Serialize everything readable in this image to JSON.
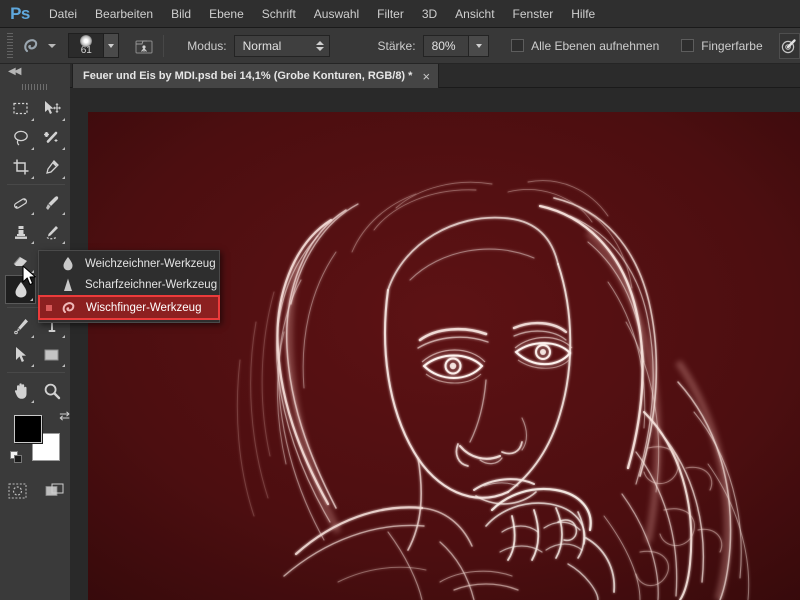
{
  "app": {
    "name": "Ps",
    "logo_color": "#5fa8dd"
  },
  "menubar": {
    "items": [
      {
        "label": "Datei"
      },
      {
        "label": "Bearbeiten"
      },
      {
        "label": "Bild"
      },
      {
        "label": "Ebene"
      },
      {
        "label": "Schrift"
      },
      {
        "label": "Auswahl"
      },
      {
        "label": "Filter"
      },
      {
        "label": "3D"
      },
      {
        "label": "Ansicht"
      },
      {
        "label": "Fenster"
      },
      {
        "label": "Hilfe"
      }
    ]
  },
  "options_bar": {
    "brush_size": "61",
    "brush_preset_icon": "soft-round-brush-icon",
    "brush_panel_icon": "brush-panel-icon",
    "mode_label": "Modus:",
    "mode_value": "Normal",
    "strength_label": "Stärke:",
    "strength_value": "80%",
    "sample_all_layers_label": "Alle Ebenen aufnehmen",
    "sample_all_layers_checked": false,
    "finger_paint_label": "Fingerfarbe",
    "finger_paint_checked": false,
    "pressure_button_icon": "tablet-pressure-icon"
  },
  "document_tab": {
    "title": "Feuer und Eis by MDI.psd bei 14,1% (Grobe Konturen, RGB/8) *",
    "close_glyph": "×"
  },
  "left_panel": {
    "collapse_glyph": "◀◀"
  },
  "toolbox": {
    "tools": [
      {
        "name": "rectangular-marquee-tool",
        "row": 0,
        "col": 0,
        "has_corner": true
      },
      {
        "name": "move-tool",
        "row": 0,
        "col": 1,
        "has_corner": true
      },
      {
        "name": "lasso-tool",
        "row": 1,
        "col": 0,
        "has_corner": true
      },
      {
        "name": "magic-wand-tool",
        "row": 1,
        "col": 1,
        "has_corner": true
      },
      {
        "name": "crop-tool",
        "row": 2,
        "col": 0,
        "has_corner": true
      },
      {
        "name": "eyedropper-tool",
        "row": 2,
        "col": 1,
        "has_corner": true
      },
      {
        "name": "healing-brush-tool",
        "row": 3,
        "col": 0,
        "has_corner": true
      },
      {
        "name": "brush-tool",
        "row": 3,
        "col": 1,
        "has_corner": true
      },
      {
        "name": "clone-stamp-tool",
        "row": 4,
        "col": 0,
        "has_corner": true
      },
      {
        "name": "history-brush-tool",
        "row": 4,
        "col": 1,
        "has_corner": true
      },
      {
        "name": "eraser-tool",
        "row": 5,
        "col": 0,
        "has_corner": true
      },
      {
        "name": "gradient-tool",
        "row": 5,
        "col": 1,
        "has_corner": true
      },
      {
        "name": "blur-tool",
        "row": 6,
        "col": 0,
        "has_corner": true,
        "active": true
      },
      {
        "name": "dodge-tool",
        "row": 6,
        "col": 1,
        "has_corner": true
      },
      {
        "name": "pen-tool",
        "row": 7,
        "col": 0,
        "has_corner": true
      },
      {
        "name": "type-tool",
        "row": 7,
        "col": 1,
        "has_corner": true
      },
      {
        "name": "path-selection-tool",
        "row": 8,
        "col": 0,
        "has_corner": true
      },
      {
        "name": "rectangle-shape-tool",
        "row": 8,
        "col": 1,
        "has_corner": true
      },
      {
        "name": "hand-tool",
        "row": 9,
        "col": 0,
        "has_corner": true
      },
      {
        "name": "zoom-tool",
        "row": 9,
        "col": 1,
        "has_corner": false
      }
    ],
    "foreground_color": "#000000",
    "background_color": "#ffffff",
    "quick_mask_icon": "quick-mask-icon",
    "screen_mode_icon": "screen-mode-icon"
  },
  "flyout_menu": {
    "items": [
      {
        "label": "Weichzeichner-Werkzeug",
        "icon": "water-drop-icon",
        "selected": false
      },
      {
        "label": "Scharfzeichner-Werkzeug",
        "icon": "sharpen-cone-icon",
        "selected": false
      },
      {
        "label": "Wischfinger-Werkzeug",
        "icon": "smudge-finger-icon",
        "selected": true
      }
    ],
    "highlight_border_color": "#ec3b3b",
    "highlight_fill_color": "#8c2020"
  },
  "canvas": {
    "background_color": "#4e0f10",
    "workspace_color": "#292929",
    "artwork_description": "glowing-edges-portrait",
    "zoom_level": "14,1%"
  }
}
